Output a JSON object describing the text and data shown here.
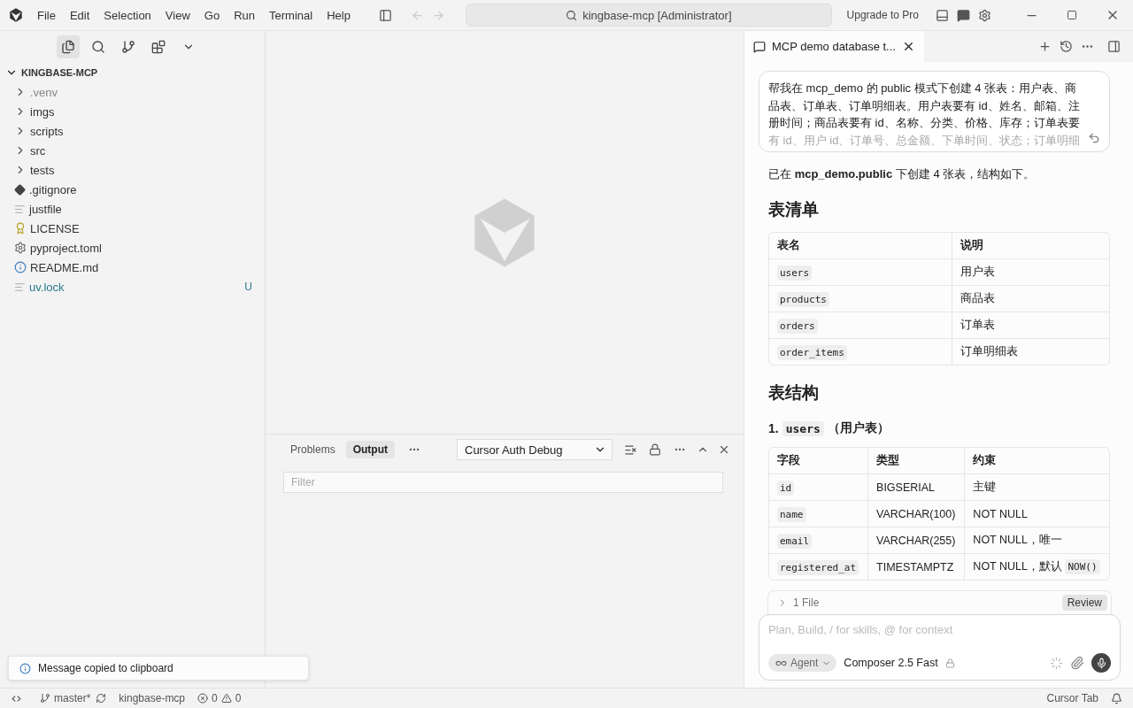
{
  "title_bar": {
    "menus": [
      "File",
      "Edit",
      "Selection",
      "View",
      "Go",
      "Run",
      "Terminal",
      "Help"
    ],
    "search": "kingbase-mcp [Administrator]",
    "upgrade": "Upgrade to Pro"
  },
  "explorer": {
    "root": "KINGBASE-MCP",
    "expanded": true,
    "children": [
      {
        "label": ".venv",
        "kind": "folder",
        "expanded": false,
        "ignored": true
      },
      {
        "label": "imgs",
        "kind": "folder",
        "expanded": false,
        "ignored": false
      },
      {
        "label": "scripts",
        "kind": "folder",
        "expanded": false,
        "ignored": false
      },
      {
        "label": "src",
        "kind": "folder",
        "expanded": false,
        "ignored": false
      },
      {
        "label": "tests",
        "kind": "folder",
        "expanded": false,
        "ignored": false
      },
      {
        "label": ".gitignore",
        "kind": "git",
        "ignored": false
      },
      {
        "label": "justfile",
        "kind": "text",
        "ignored": false
      },
      {
        "label": "LICENSE",
        "kind": "license",
        "ignored": false
      },
      {
        "label": "pyproject.toml",
        "kind": "config",
        "ignored": false
      },
      {
        "label": "README.md",
        "kind": "readme",
        "ignored": false
      },
      {
        "label": "uv.lock",
        "kind": "text",
        "ignored": false,
        "badge": "U"
      }
    ]
  },
  "panel": {
    "tabs": [
      {
        "label": "Problems",
        "selected": false
      },
      {
        "label": "Output",
        "selected": true
      }
    ],
    "channel": "Cursor Auth Debug",
    "filter_placeholder": "Filter"
  },
  "chat": {
    "tab_title": "MCP demo database t...",
    "user_message": "帮我在 mcp_demo 的 public 模式下创建 4 张表：用户表、商品表、订单表、订单明细表。用户表要有 id、姓名、邮箱、注册时间；商品表要有 id、名称、分类、价格、库存；订单表要",
    "user_message_faded": "有 id、用户 id、订单号、总金额、下单时间、状态；订单明细",
    "intro": "已在 **mcp_demo.public** 下创建 4 张表，结构如下。",
    "heading_1": "表清单",
    "tables_list": {
      "columns": [
        "表名",
        "说明"
      ],
      "rows": [
        [
          "users",
          "用户表"
        ],
        [
          "products",
          "商品表"
        ],
        [
          "orders",
          "订单表"
        ],
        [
          "order_items",
          "订单明细表"
        ]
      ]
    },
    "heading_2": "表结构",
    "subheading": {
      "number": "1.",
      "code": "users",
      "text": "（用户表）"
    },
    "users_table": {
      "columns": [
        "字段",
        "类型",
        "约束"
      ],
      "rows": [
        {
          "field": "id",
          "type": "BIGSERIAL",
          "constraint": "主键"
        },
        {
          "field": "name",
          "type": "VARCHAR(100)",
          "constraint": "NOT NULL"
        },
        {
          "field": "email",
          "type": "VARCHAR(255)",
          "constraint": "NOT NULL，唯一"
        },
        {
          "field": "registered_at",
          "type": "TIMESTAMPTZ",
          "constraint": "NOT NULL，默认",
          "constraint_code": "NOW()"
        }
      ]
    },
    "files_bar": {
      "label": "1 File",
      "button": "Review"
    },
    "composer": {
      "placeholder": "Plan, Build, / for skills, @ for context",
      "mode": "Agent",
      "model": "Composer 2.5 Fast"
    }
  },
  "toast": "Message copied to clipboard",
  "status_bar": {
    "branch": "master*",
    "project": "kingbase-mcp",
    "errors": "0",
    "warnings": "0",
    "right": "Cursor Tab"
  }
}
